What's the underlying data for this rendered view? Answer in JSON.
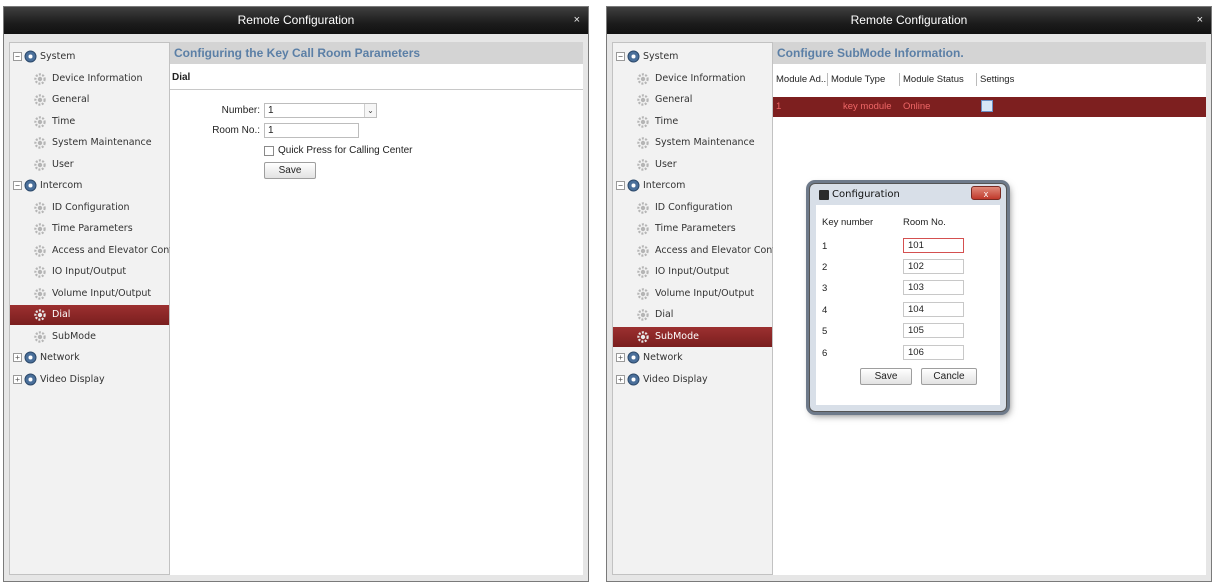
{
  "left_window": {
    "title": "Remote Configuration",
    "close": "×",
    "tree": [
      {
        "kind": "root",
        "label": "System",
        "toggle": "−"
      },
      {
        "kind": "child",
        "label": "Device Information"
      },
      {
        "kind": "child",
        "label": "General"
      },
      {
        "kind": "child",
        "label": "Time"
      },
      {
        "kind": "child",
        "label": "System Maintenance"
      },
      {
        "kind": "child",
        "label": "User"
      },
      {
        "kind": "root",
        "label": "Intercom",
        "toggle": "−"
      },
      {
        "kind": "child",
        "label": "ID Configuration"
      },
      {
        "kind": "child",
        "label": "Time Parameters"
      },
      {
        "kind": "child",
        "label": "Access and Elevator Control"
      },
      {
        "kind": "child",
        "label": "IO Input/Output"
      },
      {
        "kind": "child",
        "label": "Volume Input/Output"
      },
      {
        "kind": "child",
        "label": "Dial",
        "selected": true
      },
      {
        "kind": "child",
        "label": "SubMode"
      },
      {
        "kind": "root",
        "label": "Network",
        "toggle": "+"
      },
      {
        "kind": "root",
        "label": "Video Display",
        "toggle": "+"
      }
    ],
    "heading": "Configuring the Key Call Room Parameters",
    "subheading": "Dial",
    "form": {
      "number_label": "Number:",
      "number_value": "1",
      "room_label": "Room No.:",
      "room_value": "1",
      "checkbox_label": "Quick Press for Calling Center",
      "save_label": "Save"
    }
  },
  "right_window": {
    "title": "Remote Configuration",
    "close": "×",
    "tree": [
      {
        "kind": "root",
        "label": "System",
        "toggle": "−"
      },
      {
        "kind": "child",
        "label": "Device Information"
      },
      {
        "kind": "child",
        "label": "General"
      },
      {
        "kind": "child",
        "label": "Time"
      },
      {
        "kind": "child",
        "label": "System Maintenance"
      },
      {
        "kind": "child",
        "label": "User"
      },
      {
        "kind": "root",
        "label": "Intercom",
        "toggle": "−"
      },
      {
        "kind": "child",
        "label": "ID Configuration"
      },
      {
        "kind": "child",
        "label": "Time Parameters"
      },
      {
        "kind": "child",
        "label": "Access and Elevator Control"
      },
      {
        "kind": "child",
        "label": "IO Input/Output"
      },
      {
        "kind": "child",
        "label": "Volume Input/Output"
      },
      {
        "kind": "child",
        "label": "Dial"
      },
      {
        "kind": "child",
        "label": "SubMode",
        "selected": true
      },
      {
        "kind": "root",
        "label": "Network",
        "toggle": "+"
      },
      {
        "kind": "root",
        "label": "Video Display",
        "toggle": "+"
      }
    ],
    "heading": "Configure SubMode Information.",
    "table": {
      "columns": [
        "Module Ad...",
        "Module Type",
        "Module Status",
        "Settings"
      ],
      "rows": [
        {
          "address": "1",
          "type": "key module",
          "status": "Online",
          "settings_icon": "edit-icon"
        }
      ]
    },
    "dialog": {
      "title": "Configuration",
      "close": "x",
      "col_key": "Key number",
      "col_room": "Room No.",
      "entries": [
        {
          "key": "1",
          "room": "101"
        },
        {
          "key": "2",
          "room": "102"
        },
        {
          "key": "3",
          "room": "103"
        },
        {
          "key": "4",
          "room": "104"
        },
        {
          "key": "5",
          "room": "105"
        },
        {
          "key": "6",
          "room": "106"
        }
      ],
      "save_label": "Save",
      "cancel_label": "Cancle"
    }
  },
  "colors": {
    "selected_row": "#8a2525",
    "heading_text": "#5b7fa6",
    "titlebar": "#1c1c1c"
  }
}
